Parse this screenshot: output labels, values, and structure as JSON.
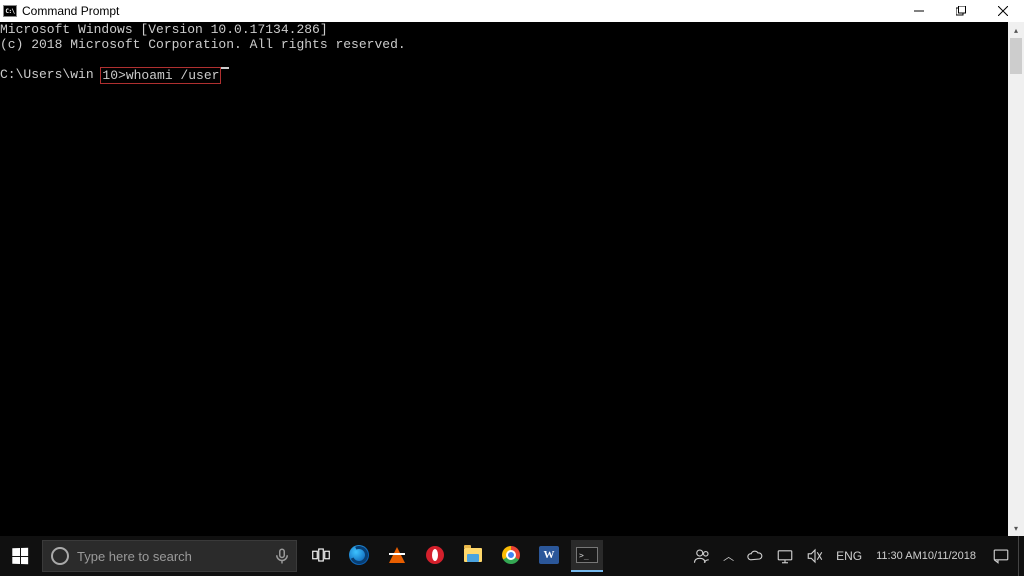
{
  "window": {
    "title": "Command Prompt",
    "icon_glyph": "C:\\"
  },
  "terminal": {
    "banner_line1": "Microsoft Windows [Version 10.0.17134.286]",
    "banner_line2": "(c) 2018 Microsoft Corporation. All rights reserved.",
    "prompt_prefix": "C:\\Users\\win ",
    "prompt_highlighted": "10>whoami /user"
  },
  "taskbar": {
    "search_placeholder": "Type here to search",
    "tray": {
      "lang": "ENG",
      "time": "11:30 AM",
      "date": "10/11/2018"
    }
  },
  "icons": {
    "taskview": "task-view",
    "edge": "edge",
    "vlc": "vlc",
    "opera": "opera",
    "explorer": "file-explorer",
    "chrome": "chrome",
    "word": "W",
    "cmd": ">_"
  }
}
